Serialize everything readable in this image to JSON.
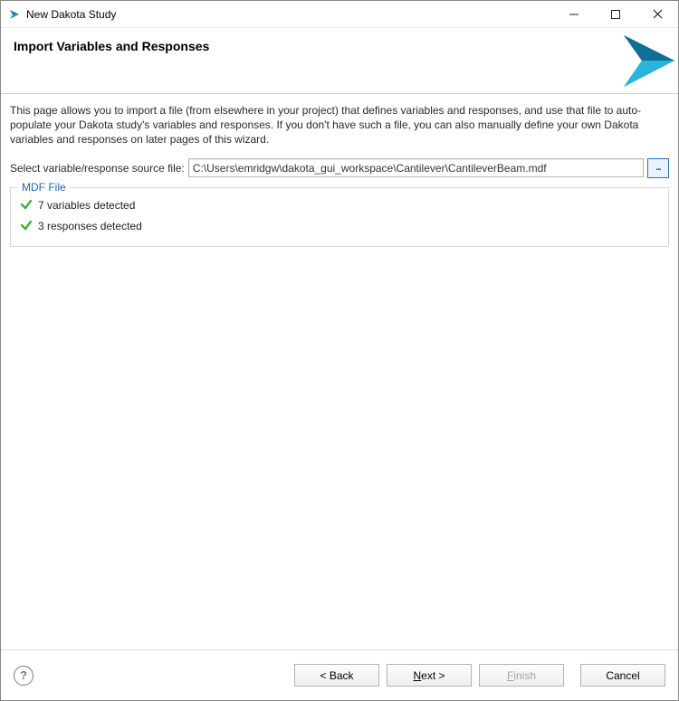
{
  "window": {
    "title": "New Dakota Study"
  },
  "header": {
    "title": "Import Variables and Responses"
  },
  "description": "This page allows you to import a file (from elsewhere in your project) that defines variables and responses, and use that file to auto-populate your Dakota study's variables and responses.  If you don't have such a file, you can also manually define your own Dakota variables and responses on later pages of this wizard.",
  "file_selector": {
    "label": "Select variable/response source file:",
    "value": "C:\\Users\\emridgw\\dakota_gui_workspace\\Cantilever\\CantileverBeam.mdf",
    "browse_label": "..."
  },
  "mdf_group": {
    "legend": "MDF File",
    "items": [
      "7 variables detected",
      "3 responses detected"
    ]
  },
  "buttons": {
    "back": "< Back",
    "next_prefix": "N",
    "next_suffix": "ext >",
    "finish_prefix": "F",
    "finish_suffix": "inish",
    "cancel": "Cancel"
  }
}
